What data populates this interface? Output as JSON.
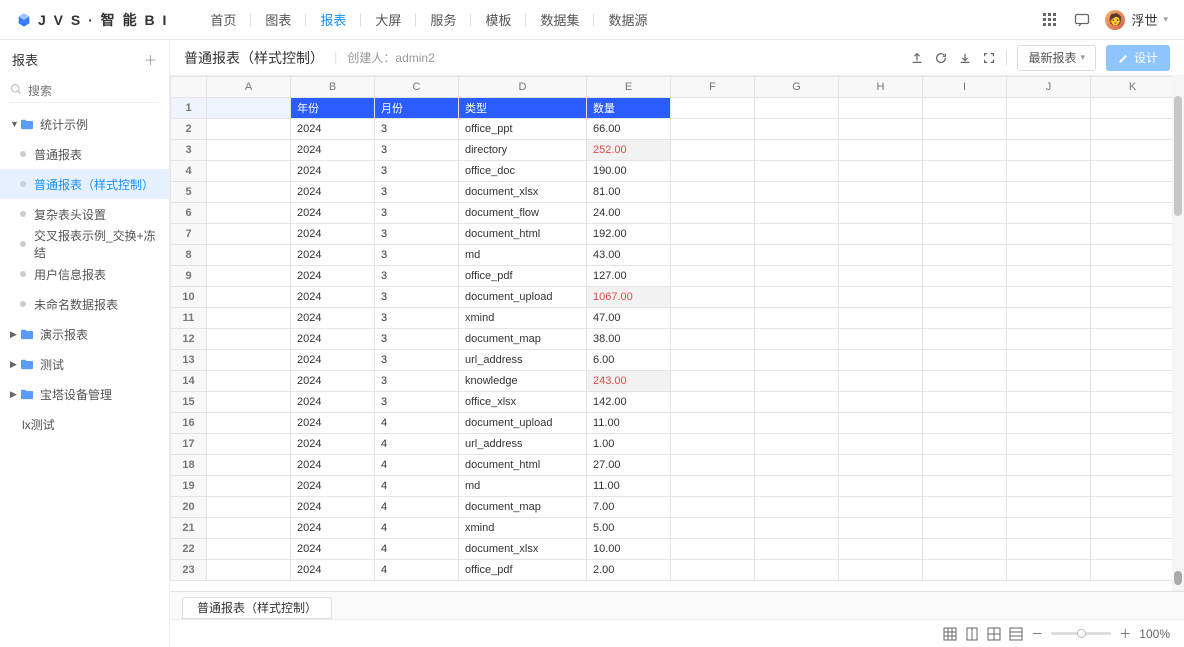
{
  "brand": "J V S · 智 能 B I",
  "nav": {
    "items": [
      "首页",
      "图表",
      "报表",
      "大屏",
      "服务",
      "模板",
      "数据集",
      "数据源"
    ],
    "active": 2
  },
  "user": {
    "name": "浮世"
  },
  "sidebar": {
    "title": "报表",
    "search_placeholder": "搜索",
    "tree": [
      {
        "type": "folder",
        "label": "统计示例",
        "open": true,
        "children": [
          {
            "label": "普通报表"
          },
          {
            "label": "普通报表（样式控制）",
            "selected": true
          },
          {
            "label": "复杂表头设置"
          },
          {
            "label": "交叉报表示例_交换+冻结"
          },
          {
            "label": "用户信息报表"
          },
          {
            "label": "未命名数据报表"
          }
        ]
      },
      {
        "type": "folder",
        "label": "演示报表",
        "open": false
      },
      {
        "type": "folder",
        "label": "测试",
        "open": false
      },
      {
        "type": "folder",
        "label": "宝塔设备管理",
        "open": false
      },
      {
        "type": "leaf",
        "label": "lx测试"
      }
    ]
  },
  "crumb": {
    "title": "普通报表（样式控制）",
    "meta": "创建人：admin2",
    "buttons": {
      "latest": "最新报表",
      "design": "设计"
    }
  },
  "sheet": {
    "columns": [
      "A",
      "B",
      "C",
      "D",
      "E",
      "F",
      "G",
      "H",
      "I",
      "J",
      "K"
    ],
    "header": {
      "B": "年份",
      "C": "月份",
      "D": "类型",
      "E": "数量"
    },
    "rows": [
      {
        "n": 2,
        "B": "2024",
        "C": "3",
        "D": "office_ppt",
        "E": "66.00"
      },
      {
        "n": 3,
        "B": "2024",
        "C": "3",
        "D": "directory",
        "E": "252.00",
        "red": true
      },
      {
        "n": 4,
        "B": "2024",
        "C": "3",
        "D": "office_doc",
        "E": "190.00"
      },
      {
        "n": 5,
        "B": "2024",
        "C": "3",
        "D": "document_xlsx",
        "E": "81.00"
      },
      {
        "n": 6,
        "B": "2024",
        "C": "3",
        "D": "document_flow",
        "E": "24.00"
      },
      {
        "n": 7,
        "B": "2024",
        "C": "3",
        "D": "document_html",
        "E": "192.00"
      },
      {
        "n": 8,
        "B": "2024",
        "C": "3",
        "D": "md",
        "E": "43.00"
      },
      {
        "n": 9,
        "B": "2024",
        "C": "3",
        "D": "office_pdf",
        "E": "127.00"
      },
      {
        "n": 10,
        "B": "2024",
        "C": "3",
        "D": "document_upload",
        "E": "1067.00",
        "red": true
      },
      {
        "n": 11,
        "B": "2024",
        "C": "3",
        "D": "xmind",
        "E": "47.00"
      },
      {
        "n": 12,
        "B": "2024",
        "C": "3",
        "D": "document_map",
        "E": "38.00"
      },
      {
        "n": 13,
        "B": "2024",
        "C": "3",
        "D": "url_address",
        "E": "6.00"
      },
      {
        "n": 14,
        "B": "2024",
        "C": "3",
        "D": "knowledge",
        "E": "243.00",
        "red": true
      },
      {
        "n": 15,
        "B": "2024",
        "C": "3",
        "D": "office_xlsx",
        "E": "142.00"
      },
      {
        "n": 16,
        "B": "2024",
        "C": "4",
        "D": "document_upload",
        "E": "11.00"
      },
      {
        "n": 17,
        "B": "2024",
        "C": "4",
        "D": "url_address",
        "E": "1.00"
      },
      {
        "n": 18,
        "B": "2024",
        "C": "4",
        "D": "document_html",
        "E": "27.00"
      },
      {
        "n": 19,
        "B": "2024",
        "C": "4",
        "D": "md",
        "E": "11.00"
      },
      {
        "n": 20,
        "B": "2024",
        "C": "4",
        "D": "document_map",
        "E": "7.00"
      },
      {
        "n": 21,
        "B": "2024",
        "C": "4",
        "D": "xmind",
        "E": "5.00"
      },
      {
        "n": 22,
        "B": "2024",
        "C": "4",
        "D": "document_xlsx",
        "E": "10.00"
      },
      {
        "n": 23,
        "B": "2024",
        "C": "4",
        "D": "office_pdf",
        "E": "2.00"
      }
    ],
    "tab": "普通报表（样式控制）"
  },
  "status": {
    "zoom": "100%"
  }
}
